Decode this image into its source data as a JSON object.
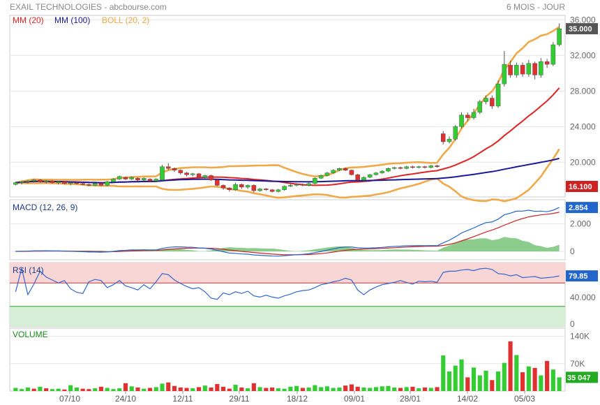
{
  "header": {
    "title": "EXAIL TECHNOLOGIES - abcbourse.com",
    "period": "6 MOIS - JOUR"
  },
  "legend": {
    "mm20": "MM (20)",
    "mm100": "MM (100)",
    "boll": "BOLL (20, 2)",
    "macd": "MACD (12, 26, 9)",
    "rsi": "RSI (14)",
    "volume": "VOLUME"
  },
  "colors": {
    "up": "#33cc33",
    "down": "#e03030",
    "mm20": "#dd2222",
    "mm100": "#1a1a99",
    "boll": "#f0a848",
    "macd_line": "#2266cc",
    "macd_signal": "#cc2222",
    "macd_hist": "#66bb66",
    "rsi_line": "#3366cc",
    "rsi_high_zone": "#f9d6d6",
    "rsi_low_zone": "#d6eed6"
  },
  "chart_data": {
    "type": "candlestick",
    "x_labels": [
      "07/10",
      "24/10",
      "12/11",
      "29/11",
      "18/12",
      "09/01",
      "28/01",
      "14/02",
      "05/03"
    ],
    "price": {
      "ylim": [
        16.1,
        36.5
      ],
      "ticks": [
        "36.000",
        "32.000",
        "28.000",
        "24.000",
        "20.000"
      ],
      "last_value": "35.000",
      "low_value": "16.100",
      "candles": [
        [
          17.5,
          17.7,
          17.4,
          17.8
        ],
        [
          17.7,
          17.8,
          17.5,
          17.9
        ],
        [
          17.8,
          17.9,
          17.6,
          18.0
        ],
        [
          17.9,
          18.0,
          17.7,
          18.1
        ],
        [
          18.0,
          17.8,
          17.7,
          18.1
        ],
        [
          17.8,
          17.9,
          17.6,
          18.0
        ],
        [
          17.9,
          17.7,
          17.6,
          18.0
        ],
        [
          17.7,
          17.8,
          17.5,
          17.9
        ],
        [
          17.8,
          17.6,
          17.5,
          17.9
        ],
        [
          17.6,
          17.7,
          17.4,
          17.8
        ],
        [
          17.7,
          17.6,
          17.5,
          17.8
        ],
        [
          17.6,
          17.5,
          17.4,
          17.7
        ],
        [
          17.5,
          17.4,
          17.3,
          17.6
        ],
        [
          17.4,
          17.6,
          17.3,
          17.7
        ],
        [
          17.6,
          17.4,
          17.3,
          17.7
        ],
        [
          17.4,
          17.8,
          17.3,
          17.9
        ],
        [
          17.8,
          18.1,
          17.7,
          18.2
        ],
        [
          18.1,
          18.4,
          18.0,
          18.5
        ],
        [
          18.3,
          18.1,
          18.0,
          18.4
        ],
        [
          18.1,
          18.3,
          18.0,
          18.4
        ],
        [
          18.2,
          18.0,
          17.9,
          18.3
        ],
        [
          18.0,
          18.2,
          17.9,
          18.3
        ],
        [
          18.1,
          17.9,
          17.8,
          18.2
        ],
        [
          17.9,
          18.1,
          17.8,
          18.2
        ],
        [
          18.0,
          19.5,
          17.9,
          19.7
        ],
        [
          19.5,
          19.3,
          19.1,
          19.9
        ],
        [
          19.3,
          19.1,
          18.9,
          19.4
        ],
        [
          19.1,
          18.8,
          18.6,
          19.2
        ],
        [
          18.8,
          18.6,
          18.4,
          18.9
        ],
        [
          18.6,
          18.7,
          18.4,
          18.8
        ],
        [
          18.7,
          18.3,
          18.2,
          18.8
        ],
        [
          18.3,
          18.5,
          18.2,
          18.6
        ],
        [
          18.5,
          18.0,
          17.9,
          18.6
        ],
        [
          18.0,
          17.4,
          17.3,
          18.1
        ],
        [
          17.4,
          17.1,
          16.9,
          17.5
        ],
        [
          17.1,
          16.9,
          16.7,
          17.2
        ],
        [
          16.9,
          17.5,
          16.8,
          17.7
        ],
        [
          17.5,
          17.2,
          17.0,
          17.6
        ],
        [
          17.2,
          17.4,
          17.0,
          17.5
        ],
        [
          17.4,
          16.8,
          16.6,
          17.5
        ],
        [
          16.8,
          17.0,
          16.7,
          17.1
        ],
        [
          17.0,
          16.9,
          16.8,
          17.1
        ],
        [
          16.9,
          16.7,
          16.6,
          17.0
        ],
        [
          16.7,
          16.9,
          16.6,
          17.0
        ],
        [
          16.9,
          17.3,
          16.8,
          17.4
        ],
        [
          17.3,
          17.4,
          17.2,
          17.6
        ],
        [
          17.4,
          17.5,
          17.3,
          17.6
        ],
        [
          17.5,
          17.4,
          17.3,
          17.6
        ],
        [
          17.4,
          17.6,
          17.3,
          17.7
        ],
        [
          17.6,
          18.2,
          17.5,
          18.3
        ],
        [
          18.2,
          18.5,
          18.1,
          18.6
        ],
        [
          18.5,
          18.8,
          18.4,
          18.9
        ],
        [
          18.8,
          19.1,
          18.7,
          19.2
        ],
        [
          19.1,
          19.3,
          19.0,
          19.4
        ],
        [
          19.3,
          19.1,
          19.0,
          19.4
        ],
        [
          19.1,
          18.6,
          18.5,
          19.2
        ],
        [
          18.6,
          18.0,
          17.9,
          18.7
        ],
        [
          18.0,
          18.3,
          17.9,
          18.4
        ],
        [
          18.3,
          18.6,
          18.2,
          18.7
        ],
        [
          18.6,
          18.8,
          18.5,
          18.9
        ],
        [
          18.8,
          19.0,
          18.7,
          19.1
        ],
        [
          19.0,
          19.3,
          18.9,
          19.4
        ],
        [
          19.3,
          19.4,
          19.2,
          19.5
        ],
        [
          19.4,
          19.3,
          19.2,
          19.5
        ],
        [
          19.3,
          19.5,
          19.2,
          19.6
        ],
        [
          19.5,
          19.4,
          19.3,
          19.6
        ],
        [
          19.4,
          19.5,
          19.3,
          19.6
        ],
        [
          19.5,
          19.4,
          19.3,
          19.6
        ],
        [
          19.4,
          19.6,
          19.3,
          19.7
        ],
        [
          19.6,
          19.5,
          19.4,
          19.7
        ],
        [
          23.2,
          22.3,
          22.0,
          23.5
        ],
        [
          22.3,
          22.6,
          22.1,
          22.9
        ],
        [
          22.6,
          24.0,
          22.4,
          24.2
        ],
        [
          24.0,
          25.3,
          23.8,
          25.6
        ],
        [
          25.3,
          25.0,
          24.6,
          25.6
        ],
        [
          25.0,
          25.6,
          24.8,
          26.0
        ],
        [
          25.6,
          26.8,
          25.4,
          27.0
        ],
        [
          26.8,
          27.2,
          26.5,
          27.5
        ],
        [
          27.2,
          26.3,
          26.0,
          27.5
        ],
        [
          26.3,
          28.8,
          26.1,
          29.2
        ],
        [
          28.8,
          31.0,
          28.5,
          32.5
        ],
        [
          30.9,
          29.8,
          29.5,
          31.4
        ],
        [
          29.8,
          30.9,
          29.5,
          31.2
        ],
        [
          30.9,
          29.9,
          29.6,
          31.2
        ],
        [
          29.9,
          31.1,
          29.6,
          31.5
        ],
        [
          31.1,
          29.8,
          29.3,
          31.3
        ],
        [
          29.8,
          31.3,
          29.5,
          31.7
        ],
        [
          31.3,
          31.0,
          30.6,
          31.6
        ],
        [
          31.0,
          33.2,
          30.8,
          33.5
        ],
        [
          33.2,
          35.0,
          33.0,
          35.6
        ]
      ]
    },
    "macd": {
      "ticks": [
        "2.000",
        "0"
      ],
      "last_value": "2.854"
    },
    "rsi": {
      "ticks": [
        "40.000",
        "0"
      ],
      "last_value": "79.85",
      "values": [
        55,
        95,
        50,
        68,
        90,
        80,
        75,
        70,
        74,
        60,
        54,
        52,
        72,
        76,
        74,
        62,
        67,
        74,
        65,
        62,
        58,
        67,
        60,
        72,
        86,
        84,
        75,
        69,
        64,
        60,
        62,
        55,
        44,
        42,
        53,
        50,
        55,
        52,
        56,
        48,
        46,
        49,
        46,
        44,
        48,
        51,
        55,
        57,
        58,
        62,
        67,
        69,
        72,
        74,
        78,
        75,
        58,
        50,
        58,
        63,
        67,
        69,
        71,
        74,
        71,
        68,
        73,
        72,
        73,
        71,
        88,
        90,
        90,
        92,
        93,
        91,
        94,
        95,
        93,
        86,
        85,
        82,
        84,
        79,
        80,
        81,
        78,
        79,
        80,
        82
      ]
    },
    "volume": {
      "ticks": [
        "140K",
        "70K"
      ],
      "last_value": "35 047",
      "values": [
        8,
        5,
        9,
        6,
        11,
        7,
        5,
        6,
        4,
        15,
        9,
        6,
        5,
        7,
        11,
        8,
        5,
        7,
        20,
        12,
        9,
        6,
        8,
        10,
        19,
        22,
        13,
        9,
        8,
        7,
        10,
        14,
        9,
        18,
        11,
        6,
        16,
        9,
        7,
        20,
        10,
        8,
        9,
        7,
        6,
        11,
        13,
        8,
        9,
        15,
        10,
        12,
        8,
        9,
        14,
        17,
        11,
        9,
        8,
        10,
        12,
        13,
        9,
        8,
        10,
        11,
        7,
        9,
        8,
        10,
        91,
        50,
        65,
        81,
        35,
        60,
        40,
        52,
        28,
        50,
        72,
        127,
        92,
        48,
        63,
        59,
        40,
        77,
        55,
        35
      ],
      "up_flags": [
        1,
        1,
        1,
        0,
        1,
        0,
        1,
        1,
        0,
        1,
        1,
        0,
        0,
        1,
        0,
        1,
        1,
        1,
        0,
        1,
        0,
        1,
        0,
        1,
        1,
        0,
        0,
        0,
        0,
        1,
        0,
        1,
        0,
        0,
        0,
        0,
        1,
        0,
        1,
        0,
        1,
        0,
        0,
        1,
        1,
        1,
        1,
        0,
        1,
        1,
        1,
        1,
        1,
        1,
        0,
        0,
        0,
        1,
        1,
        1,
        1,
        1,
        1,
        0,
        1,
        0,
        1,
        0,
        1,
        0,
        1,
        1,
        1,
        1,
        0,
        1,
        1,
        1,
        0,
        1,
        1,
        0,
        1,
        0,
        1,
        0,
        1,
        0,
        1,
        1
      ]
    }
  }
}
